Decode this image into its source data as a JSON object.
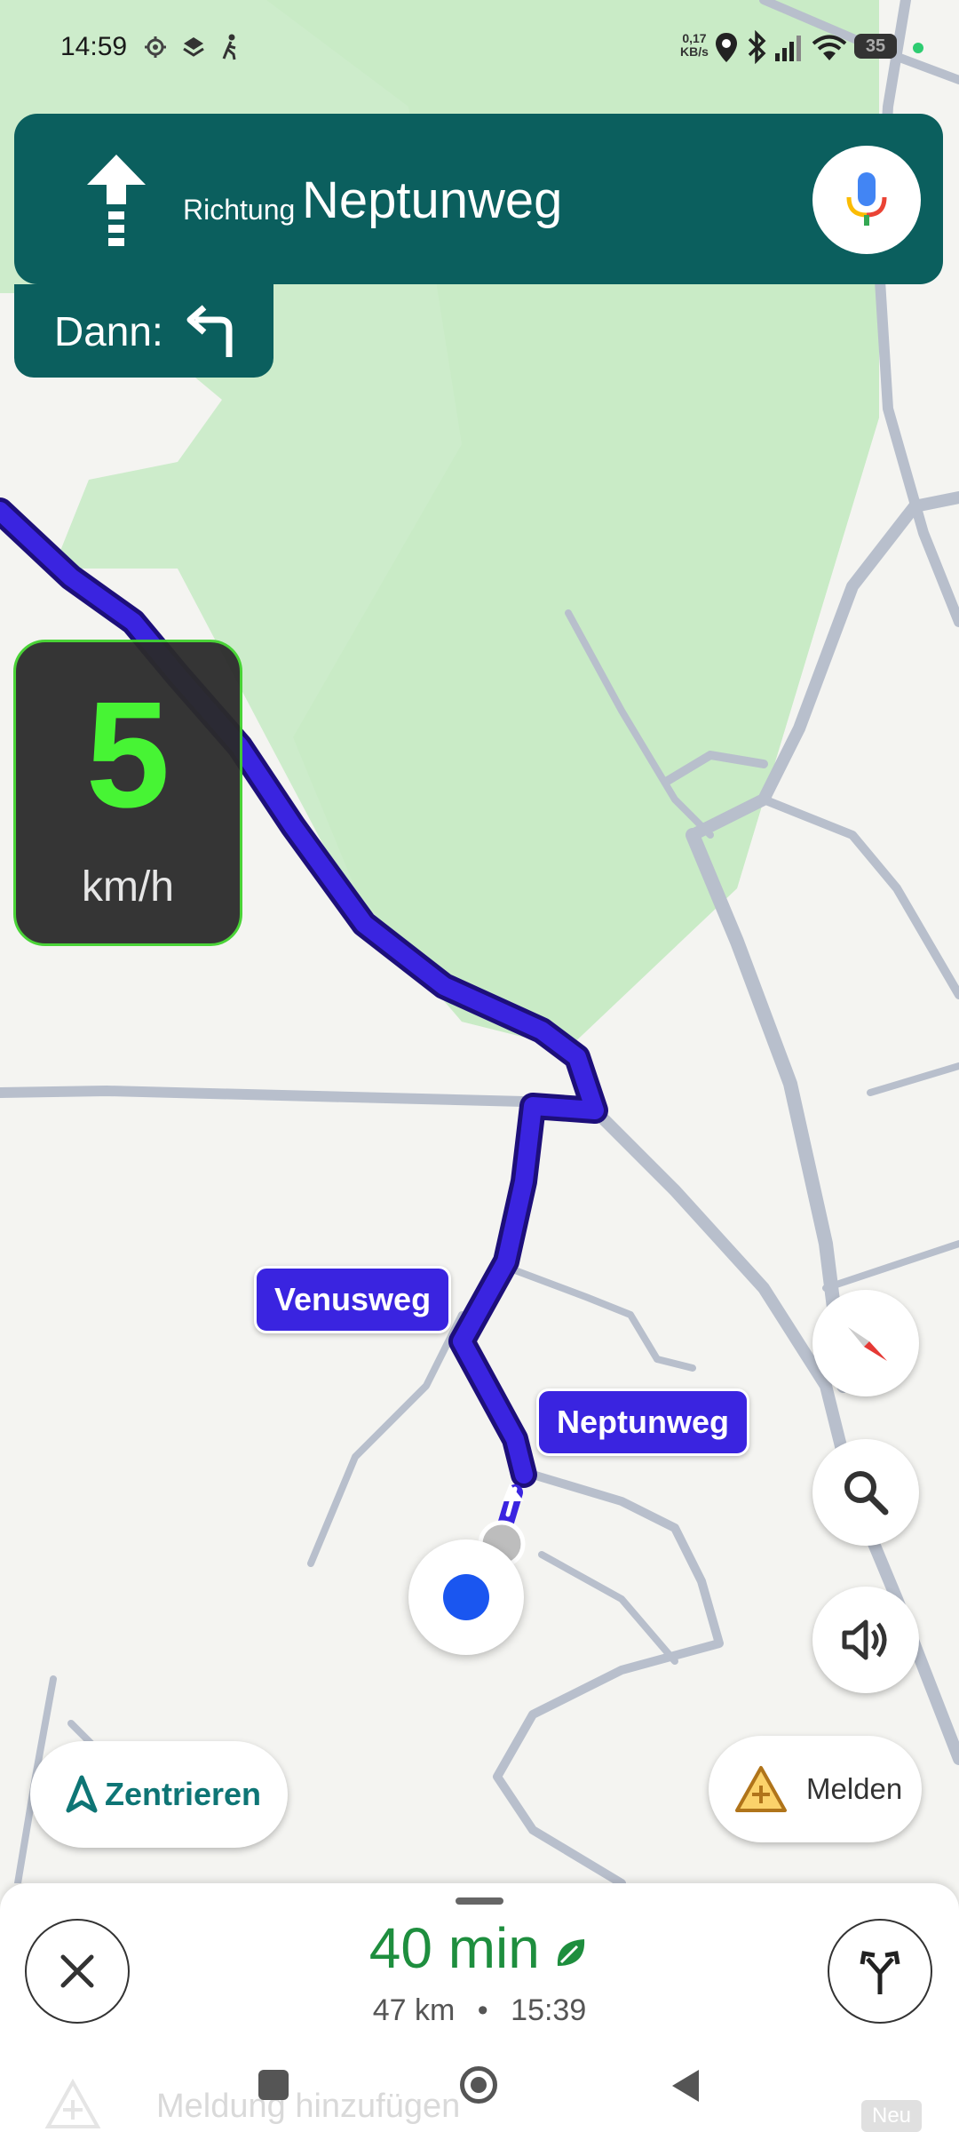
{
  "status_bar": {
    "time": "14:59",
    "speed_value": "0,17",
    "speed_unit": "KB/s",
    "battery": "35",
    "icons": [
      "location-target-icon",
      "layers-icon",
      "walking-icon",
      "location-pin-icon",
      "bluetooth-icon",
      "signal-icon",
      "wifi-icon",
      "battery-icon"
    ]
  },
  "navigation": {
    "maneuver_icon": "straight-arrow-icon",
    "toward_label": "Richtung",
    "street": "Neptunweg",
    "then_label": "Dann:",
    "then_icon": "turn-left-icon"
  },
  "speedometer": {
    "value": "5",
    "unit": "km/h"
  },
  "map": {
    "labels": [
      "Venusweg",
      "Neptunweg"
    ],
    "colors": {
      "route": "#3a24e0",
      "park": "#cdeccb",
      "road": "#b8bfcc",
      "background": "#f4f4f1",
      "position": "#1a56f0"
    }
  },
  "buttons": {
    "recenter_label": "Zentrieren",
    "report_label": "Melden"
  },
  "trip": {
    "duration": "40 min",
    "distance": "47 km",
    "separator": "•",
    "arrival": "15:39"
  },
  "background_hint": {
    "text": "Meldung hinzufügen",
    "badge": "Neu"
  }
}
